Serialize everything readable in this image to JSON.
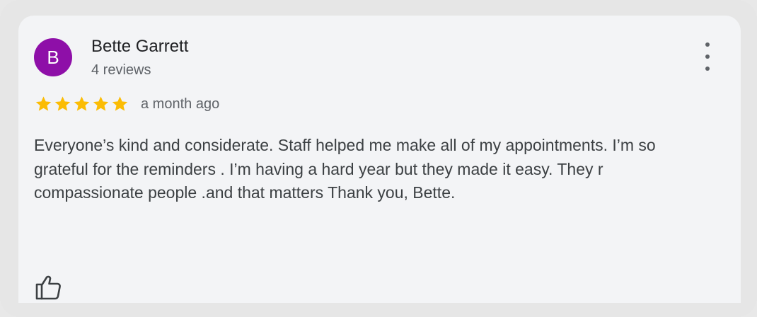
{
  "review": {
    "avatar_letter": "B",
    "avatar_color": "#8e0fa8",
    "reviewer_name": "Bette Garrett",
    "reviewer_meta": "4 reviews",
    "rating": 5,
    "rating_max": 5,
    "star_color": "#fbbc04",
    "time_ago": "a month ago",
    "text": "Everyone’s kind and considerate. Staff helped me make all of my appointments. I’m so grateful for the reminders . I’m having a hard year but they made it easy. They r compassionate people .and that matters Thank you, Bette.",
    "more_icon": "more-vert-icon",
    "like_icon": "thumbs-up-icon"
  }
}
